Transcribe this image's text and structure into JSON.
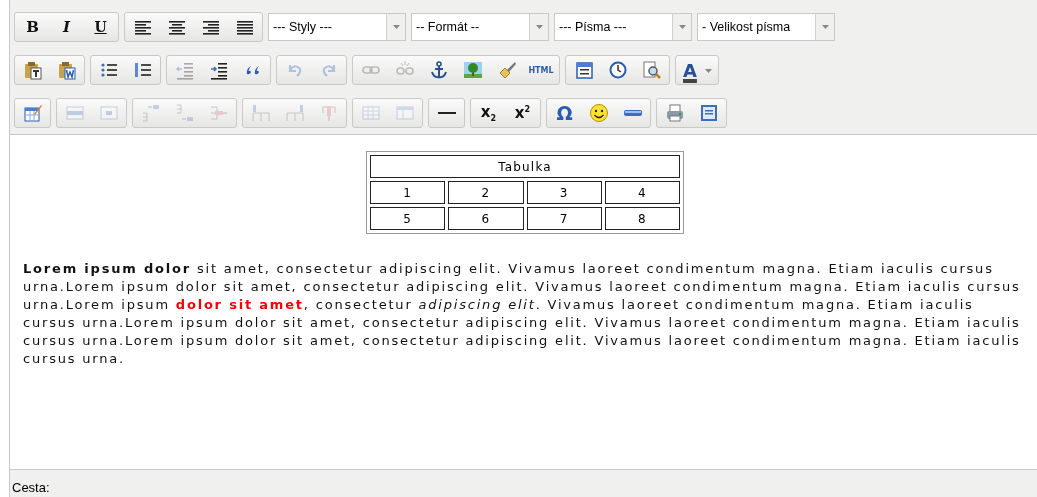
{
  "toolbars": [
    {
      "items": [
        {
          "kind": "group",
          "buttons": [
            {
              "glyph": "B",
              "disabled": false
            },
            {
              "glyph": "I",
              "disabled": false
            },
            {
              "glyph": "U",
              "disabled": false
            }
          ]
        },
        {
          "kind": "group",
          "buttons": [
            {
              "disabled": false
            },
            {
              "disabled": false
            },
            {
              "disabled": false
            },
            {
              "disabled": false
            }
          ]
        },
        {
          "kind": "select",
          "value": "--- Styly ---"
        },
        {
          "kind": "select",
          "value": "-- Formát --"
        },
        {
          "kind": "select",
          "value": "--- Písma ---"
        },
        {
          "kind": "select",
          "value": "- Velikost písma"
        }
      ]
    },
    {
      "items": [
        {
          "kind": "group",
          "buttons": [
            {
              "disabled": false
            },
            {
              "disabled": false
            }
          ]
        },
        {
          "kind": "group",
          "buttons": [
            {
              "disabled": false
            },
            {
              "disabled": false
            }
          ]
        },
        {
          "kind": "group",
          "buttons": [
            {
              "disabled": true
            },
            {
              "disabled": false
            },
            {
              "disabled": false
            }
          ]
        },
        {
          "kind": "group",
          "buttons": [
            {
              "disabled": true
            },
            {
              "disabled": true
            }
          ]
        },
        {
          "kind": "group",
          "buttons": [
            {
              "disabled": true
            },
            {
              "disabled": true
            },
            {
              "disabled": false
            },
            {
              "disabled": false
            },
            {
              "disabled": false
            },
            {
              "glyph": "HTML",
              "disabled": false
            }
          ]
        },
        {
          "kind": "group",
          "buttons": [
            {
              "disabled": false
            },
            {
              "disabled": false
            },
            {
              "disabled": false
            }
          ]
        },
        {
          "kind": "group",
          "buttons": [
            {
              "glyph": "A",
              "disabled": false,
              "dropdown": true
            }
          ]
        }
      ]
    },
    {
      "items": [
        {
          "kind": "group",
          "buttons": [
            {
              "disabled": false
            }
          ]
        },
        {
          "kind": "group",
          "buttons": [
            {
              "disabled": true
            },
            {
              "disabled": true
            }
          ]
        },
        {
          "kind": "group",
          "buttons": [
            {
              "disabled": true
            },
            {
              "disabled": true
            },
            {
              "disabled": true
            }
          ]
        },
        {
          "kind": "group",
          "buttons": [
            {
              "disabled": true
            },
            {
              "disabled": true
            },
            {
              "disabled": true
            }
          ]
        },
        {
          "kind": "group",
          "buttons": [
            {
              "disabled": true
            },
            {
              "disabled": true
            }
          ]
        },
        {
          "kind": "group",
          "buttons": [
            {
              "disabled": false
            }
          ]
        },
        {
          "kind": "group",
          "buttons": [
            {
              "glyph": "x$_{2}$",
              "disabled": false
            },
            {
              "glyph": "x$^{2}$",
              "disabled": false
            }
          ]
        },
        {
          "kind": "group",
          "buttons": [
            {
              "glyph": "Ω",
              "disabled": false
            },
            {
              "disabled": false
            },
            {
              "disabled": false
            }
          ]
        },
        {
          "kind": "group",
          "buttons": [
            {
              "disabled": false
            },
            {
              "disabled": false
            }
          ]
        }
      ]
    }
  ],
  "table": {
    "caption": "Tabulka",
    "rows": [
      [
        "1",
        "2",
        "3",
        "4"
      ],
      [
        "5",
        "6",
        "7",
        "8"
      ]
    ]
  },
  "paragraph": [
    {
      "kind": "bold",
      "text": "Lorem ipsum dolor"
    },
    {
      "kind": "plain",
      "text": " sit amet, consectetur adipiscing elit. Vivamus laoreet condimentum magna. Etiam iaculis cursus urna.Lorem ipsum dolor sit amet, consectetur adipiscing elit. Vivamus laoreet condimentum magna. Etiam iaculis cursus urna.Lorem ipsum "
    },
    {
      "kind": "bold-red",
      "text": "dolor sit amet"
    },
    {
      "kind": "plain",
      "text": ", consectetur "
    },
    {
      "kind": "italic",
      "text": "adipiscing elit"
    },
    {
      "kind": "plain",
      "text": ". Vivamus laoreet condimentum magna. Etiam iaculis cursus urna.Lorem ipsum dolor sit amet, consectetur adipiscing elit. Vivamus laoreet condimentum magna. Etiam iaculis cursus urna.Lorem ipsum dolor sit amet, consectetur adipiscing elit. Vivamus laoreet condimentum magna. Etiam iaculis cursus urna."
    }
  ],
  "status_bar": {
    "label": "Cesta:"
  }
}
